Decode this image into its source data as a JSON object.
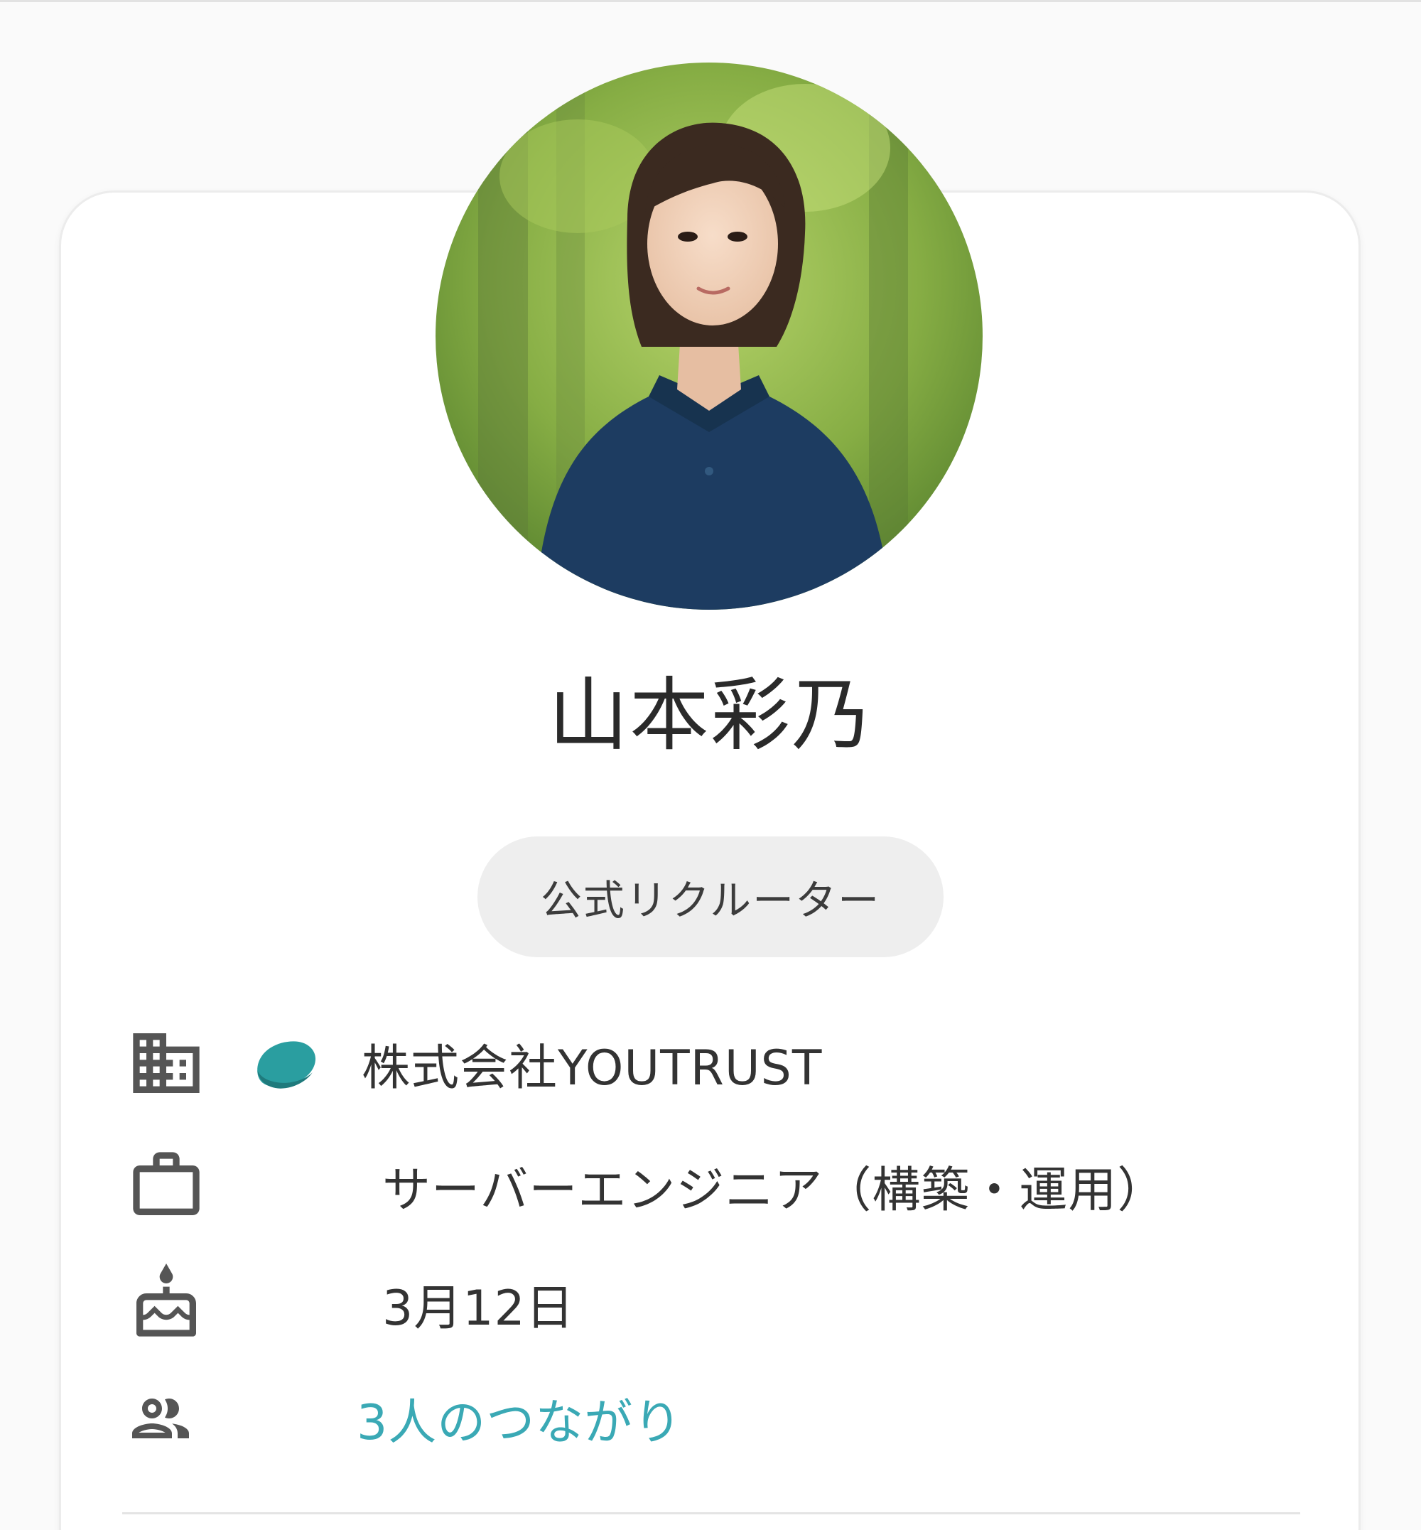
{
  "profile": {
    "name": "山本彩乃",
    "badge": "公式リクルーター",
    "company": "株式会社YOUTRUST",
    "job_title": "サーバーエンジニア（構築・運用）",
    "birthday": "3月12日",
    "connections": "3人のつながり"
  },
  "icons": {
    "company": "building-icon",
    "company_logo": "youtrust-logo",
    "job": "briefcase-icon",
    "birthday": "cake-icon",
    "connections": "people-icon"
  },
  "colors": {
    "link": "#3aa9b5",
    "logo": "#2a9ea0",
    "badge_bg": "#eeeeee",
    "text": "#2a2a2a",
    "icon": "#555555"
  }
}
